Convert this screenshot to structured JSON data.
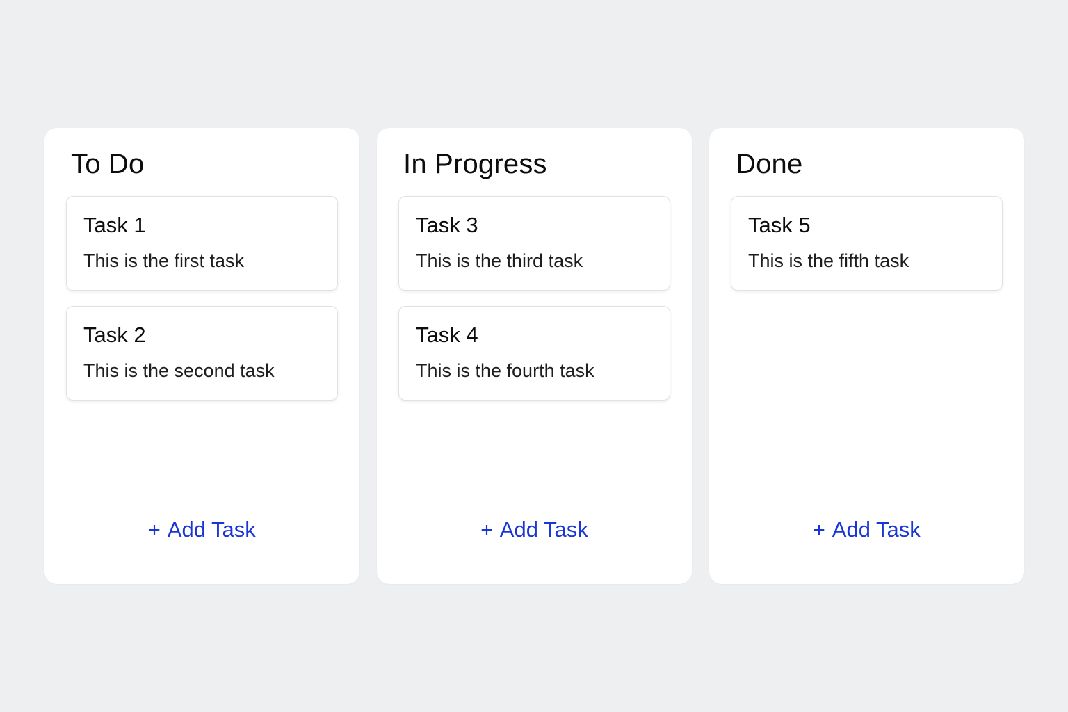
{
  "columns": [
    {
      "title": "To Do",
      "cards": [
        {
          "title": "Task 1",
          "description": "This is the first task"
        },
        {
          "title": "Task 2",
          "description": "This is the second task"
        }
      ],
      "add_label": "Add Task"
    },
    {
      "title": "In Progress",
      "cards": [
        {
          "title": "Task 3",
          "description": "This is the third task"
        },
        {
          "title": "Task 4",
          "description": "This is the fourth task"
        }
      ],
      "add_label": "Add Task"
    },
    {
      "title": "Done",
      "cards": [
        {
          "title": "Task 5",
          "description": "This is the fifth task"
        }
      ],
      "add_label": "Add Task"
    }
  ],
  "icons": {
    "add": "plus-icon"
  },
  "colors": {
    "background": "#eeeff1",
    "accent": "#1a35d6",
    "card_border": "#e1e2e5"
  }
}
